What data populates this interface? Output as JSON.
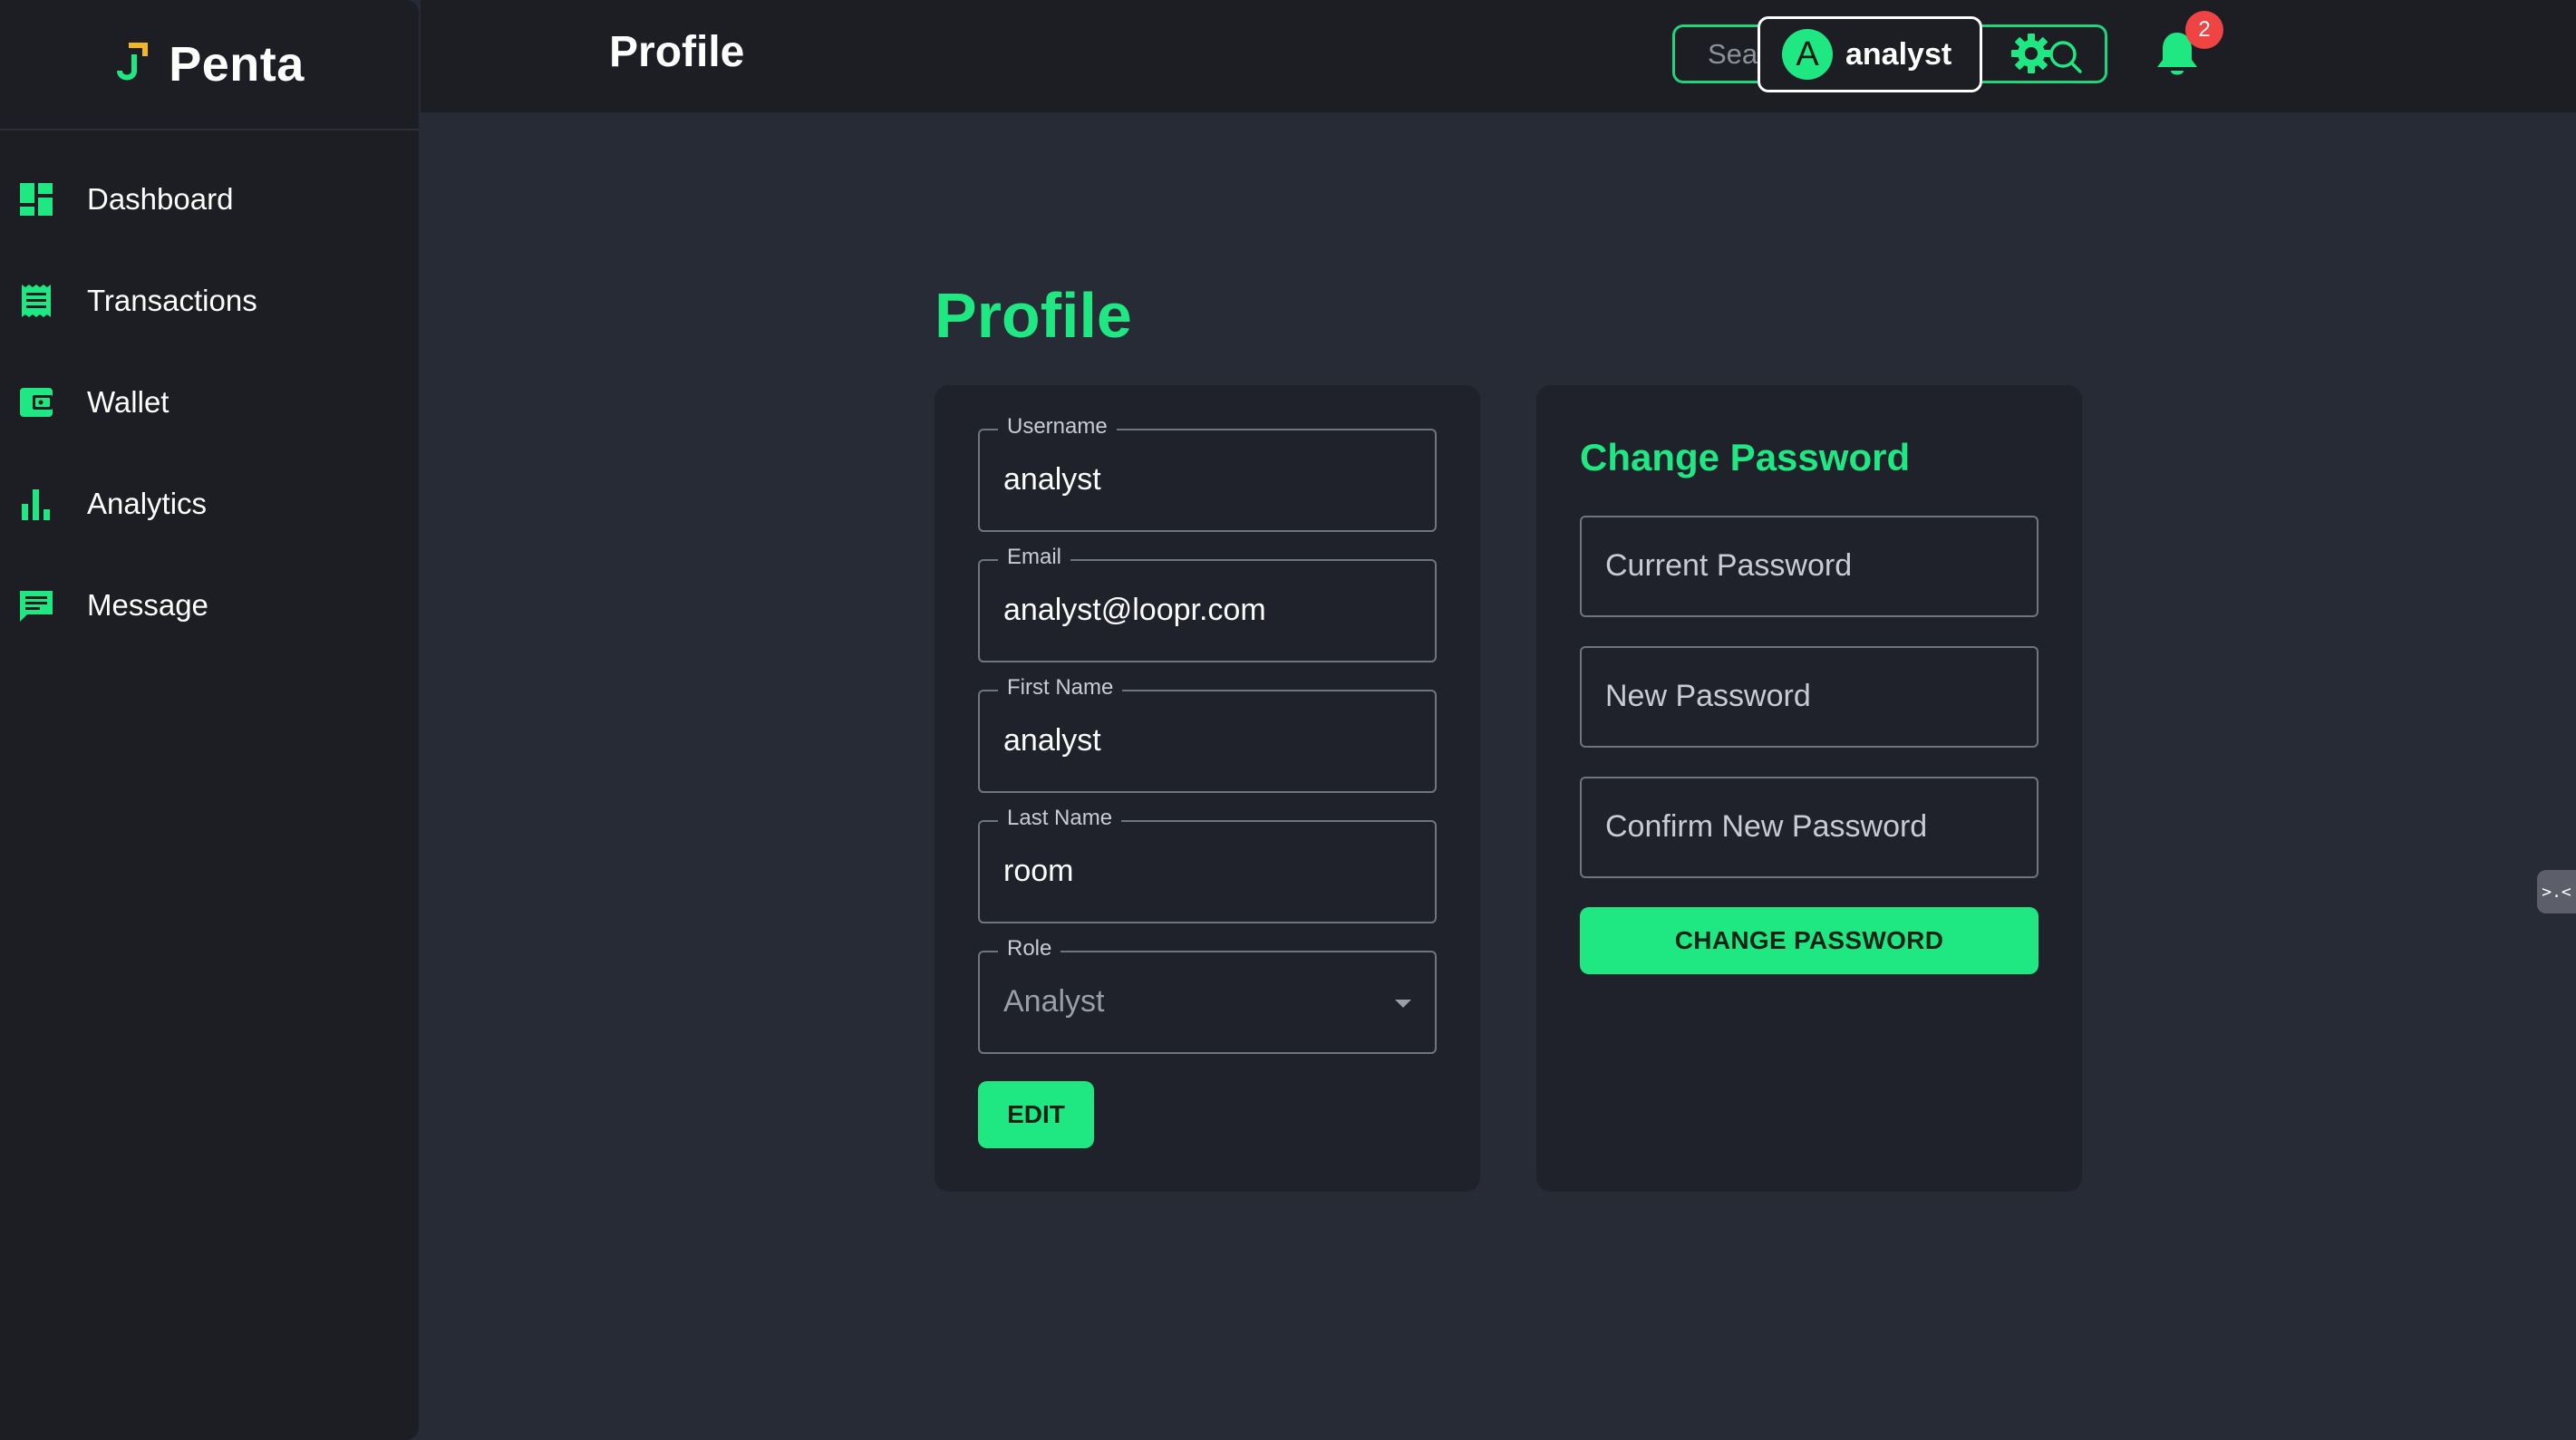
{
  "brand": {
    "name": "Penta"
  },
  "sidebar": {
    "items": [
      {
        "label": "Dashboard",
        "icon": "dashboard-icon"
      },
      {
        "label": "Transactions",
        "icon": "receipt-icon"
      },
      {
        "label": "Wallet",
        "icon": "wallet-icon"
      },
      {
        "label": "Analytics",
        "icon": "bar-chart-icon"
      },
      {
        "label": "Message",
        "icon": "message-icon"
      }
    ]
  },
  "header": {
    "title": "Profile",
    "search": {
      "placeholder": "Search...",
      "value": ""
    },
    "notifications": {
      "count": "2"
    },
    "user": {
      "initial": "A",
      "name": "analyst"
    }
  },
  "profile": {
    "heading": "Profile",
    "fields": [
      {
        "label": "Username",
        "value": "analyst"
      },
      {
        "label": "Email",
        "value": "analyst@loopr.com"
      },
      {
        "label": "First Name",
        "value": "analyst"
      },
      {
        "label": "Last Name",
        "value": "room"
      }
    ],
    "role": {
      "label": "Role",
      "value": "Analyst"
    },
    "edit_label": "EDIT"
  },
  "password": {
    "title": "Change Password",
    "current_placeholder": "Current Password",
    "new_placeholder": "New Password",
    "confirm_placeholder": "Confirm New Password",
    "submit_label": "CHANGE PASSWORD"
  },
  "colors": {
    "accent": "#1fe882",
    "sidebar_bg": "#1c1e24",
    "page_bg": "#272b36",
    "card_bg": "#1f222b",
    "badge": "#f04444"
  }
}
